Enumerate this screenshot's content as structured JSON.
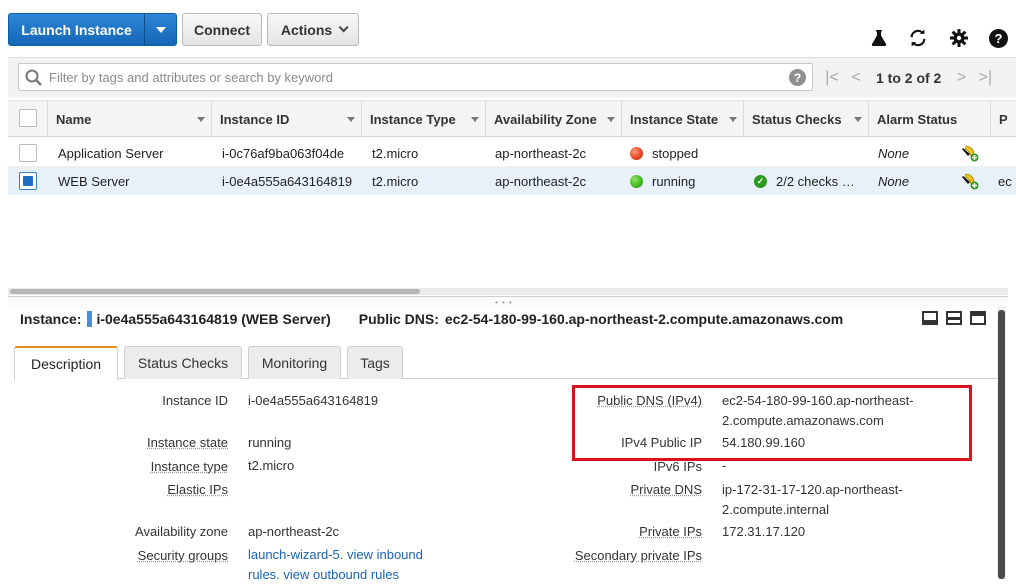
{
  "toolbar": {
    "launch_label": "Launch Instance",
    "connect_label": "Connect",
    "actions_label": "Actions",
    "icons": [
      "flask-icon",
      "refresh-icon",
      "gear-icon",
      "help-icon"
    ]
  },
  "search": {
    "placeholder": "Filter by tags and attributes or search by keyword",
    "help": "?"
  },
  "pager": {
    "first": "|<",
    "prev": "<",
    "text": "1 to 2 of 2",
    "next": ">",
    "last": ">|"
  },
  "table": {
    "columns": [
      "Name",
      "Instance ID",
      "Instance Type",
      "Availability Zone",
      "Instance State",
      "Status Checks",
      "Alarm Status",
      "P"
    ],
    "rows": [
      {
        "name": "Application Server",
        "id": "i-0c76af9ba063f04de",
        "type": "t2.micro",
        "az": "ap-northeast-2c",
        "state": "stopped",
        "state_color": "#e0441d",
        "checks": "",
        "alarm": "None",
        "extra": "",
        "selected": false
      },
      {
        "name": "WEB Server",
        "id": "i-0e4a555a643164819",
        "type": "t2.micro",
        "az": "ap-northeast-2c",
        "state": "running",
        "state_color": "#3fb51b",
        "checks": "2/2 checks …",
        "alarm": "None",
        "extra": "ec",
        "selected": true
      }
    ]
  },
  "detail": {
    "instance_label": "Instance:",
    "instance_value": "i-0e4a555a643164819 (WEB Server)",
    "dns_label": "Public DNS:",
    "dns_value": "ec2-54-180-99-160.ap-northeast-2.compute.amazonaws.com",
    "tabs": [
      "Description",
      "Status Checks",
      "Monitoring",
      "Tags"
    ],
    "left": {
      "instance_id_label": "Instance ID",
      "instance_id": "i-0e4a555a643164819",
      "state_label": "Instance state",
      "state": "running",
      "type_label": "Instance type",
      "type": "t2.micro",
      "eip_label": "Elastic IPs",
      "eip": "",
      "az_label": "Availability zone",
      "az": "ap-northeast-2c",
      "sg_label": "Security groups",
      "sg_line1": "launch-wizard-5. view inbound",
      "sg_line2": "rules. view outbound rules"
    },
    "right": {
      "pubdns_label": "Public DNS (IPv4)",
      "pubdns_line1": "ec2-54-180-99-160.ap-northeast-",
      "pubdns_line2": "2.compute.amazonaws.com",
      "pubip_label": "IPv4 Public IP",
      "pubip": "54.180.99.160",
      "ipv6_label": "IPv6 IPs",
      "ipv6": "-",
      "privdns_label": "Private DNS",
      "privdns_line1": "ip-172-31-17-120.ap-northeast-",
      "privdns_line2": "2.compute.internal",
      "privip_label": "Private IPs",
      "privip": "172.31.17.120",
      "secip_label": "Secondary private IPs",
      "secip": ""
    }
  },
  "colors": {
    "primary": "#1f72c6",
    "highlight": "#d8121c",
    "tab_accent": "#e68a1f"
  }
}
